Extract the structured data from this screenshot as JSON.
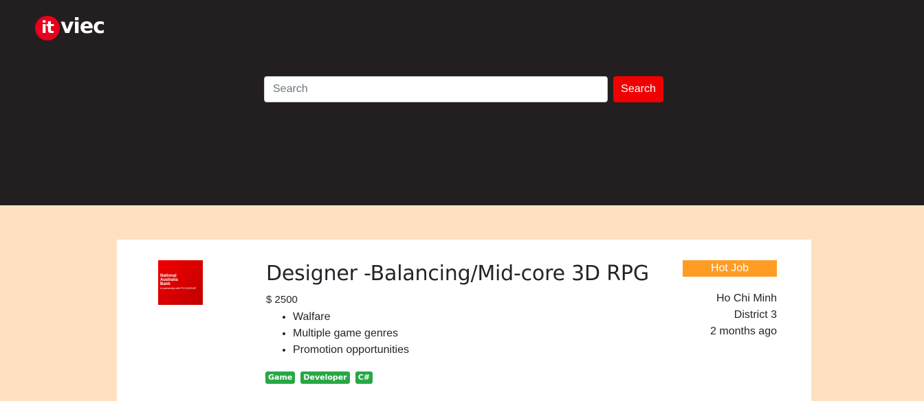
{
  "header": {
    "logo": {
      "mark": "it",
      "word": "viec"
    },
    "search": {
      "placeholder": "Search",
      "value": "",
      "button_label": "Search"
    }
  },
  "job": {
    "company_logo": {
      "brand": "National\nAustralia\nBank",
      "tagline": "In partnership with PYCOGROUP"
    },
    "title": "Designer -Balancing/Mid-core 3D RPG",
    "salary": "$ 2500",
    "benefits": [
      "Walfare",
      "Multiple game genres",
      "Promotion opportunities"
    ],
    "skills": [
      "Game",
      "Developer",
      "C#"
    ],
    "badge": "Hot Job",
    "city": "Ho Chi Minh",
    "district": "District 3",
    "posted": "2 months ago"
  },
  "colors": {
    "header_bg": "#231f20",
    "page_bg": "#ffe1c1",
    "brand_red": "#f00000",
    "hot_orange": "#ff9c23",
    "skill_green": "#28a745"
  },
  "icons": [
    "itviec-logo"
  ]
}
